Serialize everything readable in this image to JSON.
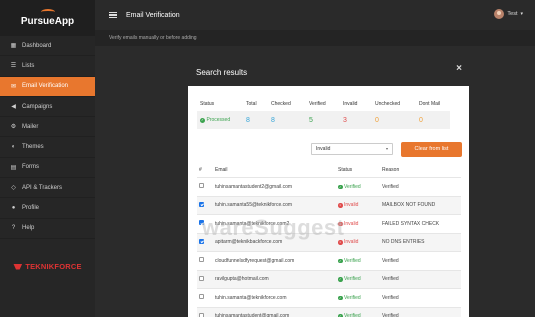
{
  "app": {
    "name": "PursueApp"
  },
  "sidebar": {
    "items": [
      {
        "label": "Dashboard",
        "icon": "dashboard-icon",
        "active": false
      },
      {
        "label": "Lists",
        "icon": "list-icon",
        "active": false
      },
      {
        "label": "Email Verification",
        "icon": "email-icon",
        "active": true
      },
      {
        "label": "Campaigns",
        "icon": "megaphone-icon",
        "active": false
      },
      {
        "label": "Mailer",
        "icon": "gear-icon",
        "active": false
      },
      {
        "label": "Themes",
        "icon": "palette-icon",
        "active": false
      },
      {
        "label": "Forms",
        "icon": "form-icon",
        "active": false
      },
      {
        "label": "API & Trackers",
        "icon": "code-icon",
        "active": false
      },
      {
        "label": "Profile",
        "icon": "user-icon",
        "active": false
      },
      {
        "label": "Help",
        "icon": "help-icon",
        "active": false
      }
    ],
    "footer_logo": "TEKNIKFORCE"
  },
  "header": {
    "title": "Email Verification",
    "user_name": "Test"
  },
  "subheader": {
    "text": "Verify emails manually or before adding"
  },
  "modal": {
    "title": "Search results",
    "close_label": "×",
    "stats": {
      "headers": [
        "Status",
        "Total",
        "Checked",
        "Verified",
        "Invalid",
        "Unchecked",
        "Dont Mail"
      ],
      "status": "Processed",
      "total": "8",
      "checked": "8",
      "verified": "5",
      "invalid": "3",
      "unchecked": "0",
      "dont_mail": "0"
    },
    "filter": {
      "value": "Invalid"
    },
    "clear_button": "Clear from list",
    "table": {
      "headers": [
        "#",
        "Email",
        "Status",
        "Reason"
      ],
      "rows": [
        {
          "checked": false,
          "email": "tuhinsamantastudent2@gmail.com",
          "status": "Verified",
          "ok": true,
          "reason": "Verified"
        },
        {
          "checked": true,
          "email": "tuhin.samanta55@teknikforce.com",
          "status": "Invalid",
          "ok": false,
          "reason": "MAILBOX NOT FOUND"
        },
        {
          "checked": true,
          "email": "tuhin.samanta@teknikforce.com2",
          "status": "Invalid",
          "ok": false,
          "reason": "FAILED SYNTAX CHECK"
        },
        {
          "checked": true,
          "email": "apitarm@teknikbackforce.com",
          "status": "Invalid",
          "ok": false,
          "reason": "NO DNS ENTRIES"
        },
        {
          "checked": false,
          "email": "cloudfunnelsdfyrequest@gmail.com",
          "status": "Verified",
          "ok": true,
          "reason": "Verified"
        },
        {
          "checked": false,
          "email": "ravilgupta@hotmail.com",
          "status": "Verified",
          "ok": true,
          "reason": "Verified"
        },
        {
          "checked": false,
          "email": "tuhin.samanta@teknikforce.com",
          "status": "Verified",
          "ok": true,
          "reason": "Verified"
        },
        {
          "checked": false,
          "email": "tuhinsamantastudent@gmail.com",
          "status": "Verified",
          "ok": true,
          "reason": "Verified"
        }
      ]
    }
  },
  "watermark": "wareSuggest",
  "colors": {
    "accent": "#e8772e",
    "verified": "#3aa24e",
    "invalid": "#e04c4c",
    "info": "#36a5d8",
    "warn": "#f0a13a"
  }
}
